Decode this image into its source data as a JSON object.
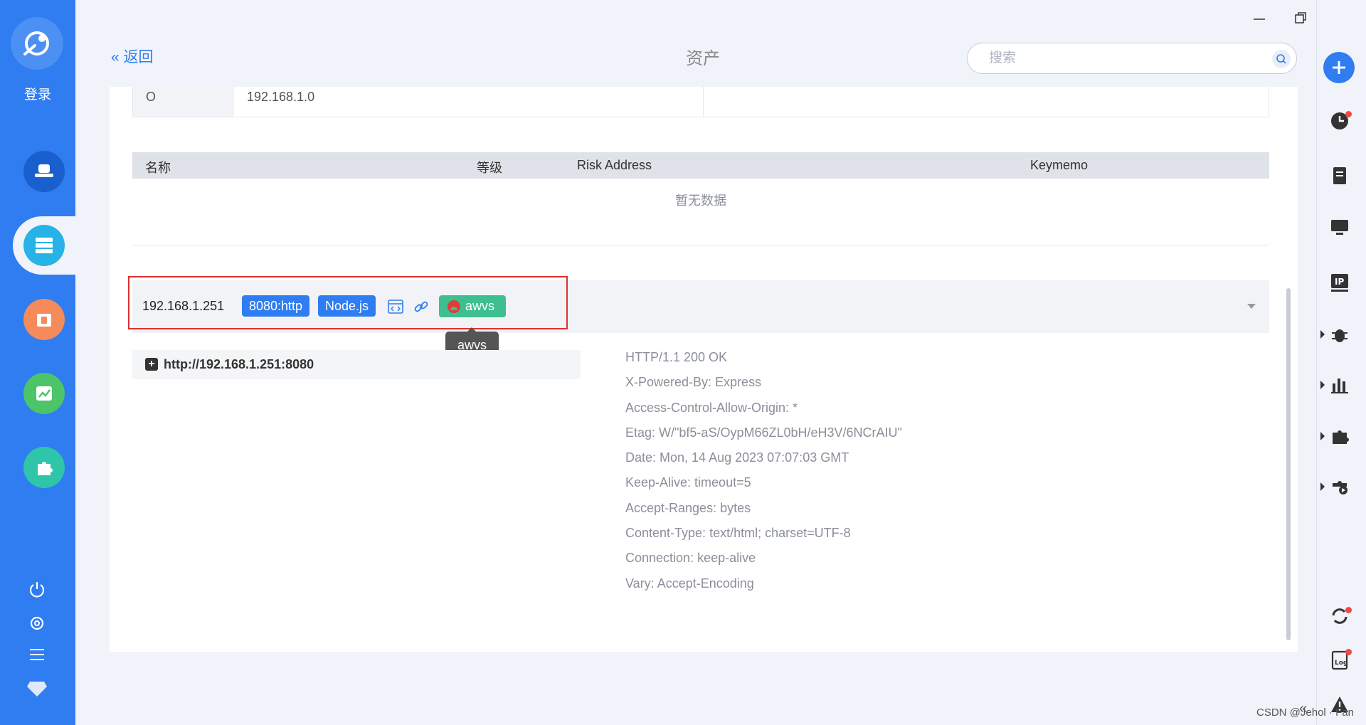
{
  "sidebar": {
    "login_label": "登录",
    "nav_items": [
      {
        "name": "hat-icon",
        "color": "#1a5fce"
      },
      {
        "name": "server-icon",
        "color": "#27b2e8",
        "active": true
      },
      {
        "name": "bug-report-icon",
        "color": "#f58a5a"
      },
      {
        "name": "chart-icon",
        "color": "#4cc468"
      },
      {
        "name": "plugin-icon",
        "color": "#2fc5a8"
      }
    ]
  },
  "header": {
    "back_label": "« 返回",
    "title": "资产",
    "search_placeholder": "搜索"
  },
  "top_row": {
    "left_cut": "O",
    "value_cut": "192.168.1.0"
  },
  "risk_table": {
    "columns": [
      "名称",
      "等级",
      "Risk Address",
      "Keymemo"
    ],
    "empty_text": "暂无数据"
  },
  "asset": {
    "ip": "192.168.1.251",
    "port_tag": "8080:http",
    "tech_tag": "Node.js",
    "scanner_tag": "awvs",
    "tooltip": "awvs",
    "url": "http://192.168.1.251:8080",
    "response_headers": [
      "HTTP/1.1 200 OK",
      "X-Powered-By: Express",
      "Access-Control-Allow-Origin: *",
      "Etag: W/\"bf5-aS/OypM66ZL0bH/eH3V/6NCrAIU\"",
      "Date: Mon, 14 Aug 2023 07:07:03 GMT",
      "Keep-Alive: timeout=5",
      "Accept-Ranges: bytes",
      "Content-Type: text/html; charset=UTF-8",
      "Connection: keep-alive",
      "Vary: Accept-Encoding"
    ]
  },
  "watermark": "CSDN @Jehol · Fan",
  "colors": {
    "primary": "#2f7df0",
    "green_tag": "#3dbf8f",
    "highlight": "#e03030"
  }
}
